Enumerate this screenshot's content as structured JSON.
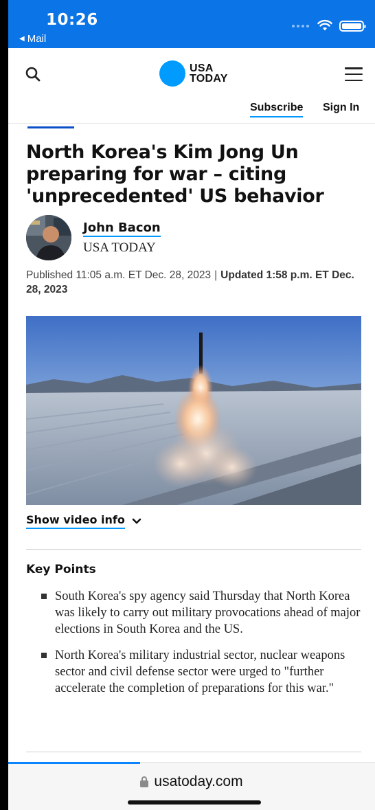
{
  "status_bar": {
    "time": "10:26",
    "back_app": "Mail",
    "back_icon": "back-triangle-icon",
    "wifi_icon": "wifi-icon",
    "battery_icon": "battery-icon",
    "background": "#0b74e6"
  },
  "header": {
    "logo_line1": "USA",
    "logo_line2": "TODAY",
    "logo_color": "#009bff",
    "search_icon": "search-icon",
    "menu_icon": "hamburger-menu-icon",
    "subscribe_label": "Subscribe",
    "signin_label": "Sign In"
  },
  "article": {
    "headline": "North Korea's Kim Jong Un preparing for war – citing 'unprecedented' US behavior",
    "author_name": "John Bacon",
    "author_org": "USA TODAY",
    "published": "Published 11:05 a.m. ET Dec. 28, 2023",
    "separator": "|",
    "updated": "Updated 1:58 p.m. ET Dec. 28, 2023",
    "video_info_label": "Show video info",
    "key_points_title": "Key Points",
    "key_points": [
      "South Korea's spy agency said Thursday that North Korea was likely to carry out military provocations ahead of major elections in South Korea and the US.",
      "North Korea's military industrial sector, nuclear weapons sector and civil defense sector were urged to \"further accelerate the completion of preparations for this war.\""
    ]
  },
  "browser": {
    "url": "usatoday.com",
    "lock_icon": "lock-icon",
    "load_progress_fraction": 0.36
  },
  "colors": {
    "link_underline": "#0098fe",
    "accent_bar": "#0b4fc8"
  }
}
